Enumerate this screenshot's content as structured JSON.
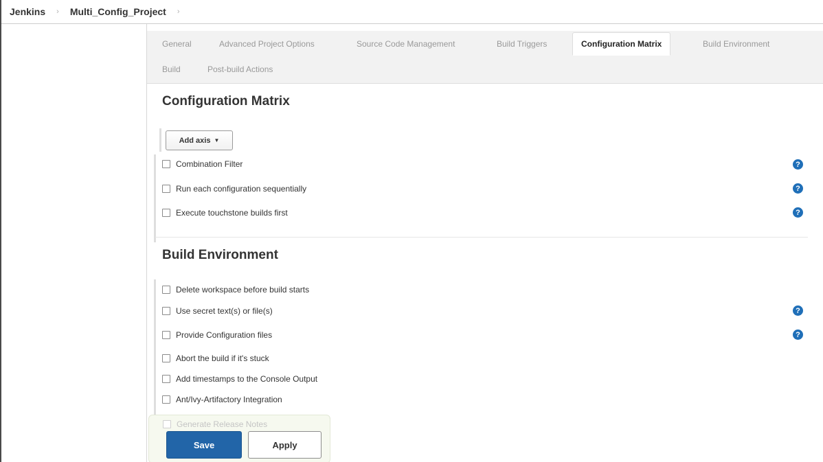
{
  "breadcrumb": {
    "root": "Jenkins",
    "project": "Multi_Config_Project"
  },
  "tabs": [
    {
      "label": "General"
    },
    {
      "label": "Advanced Project Options"
    },
    {
      "label": "Source Code Management"
    },
    {
      "label": "Build Triggers"
    },
    {
      "label": "Configuration Matrix",
      "active": true
    },
    {
      "label": "Build Environment"
    },
    {
      "label": "Build"
    },
    {
      "label": "Post-build Actions"
    }
  ],
  "configuration_matrix": {
    "title": "Configuration Matrix",
    "add_axis_label": "Add axis",
    "options": [
      {
        "label": "Combination Filter",
        "checked": false,
        "has_help": true
      },
      {
        "label": "Run each configuration sequentially",
        "checked": false,
        "has_help": true
      },
      {
        "label": "Execute touchstone builds first",
        "checked": false,
        "has_help": true
      }
    ]
  },
  "build_environment": {
    "title": "Build Environment",
    "options": [
      {
        "label": "Delete workspace before build starts",
        "checked": false,
        "has_help": false
      },
      {
        "label": "Use secret text(s) or file(s)",
        "checked": false,
        "has_help": true
      },
      {
        "label": "Provide Configuration files",
        "checked": false,
        "has_help": true
      },
      {
        "label": "Abort the build if it's stuck",
        "checked": false,
        "has_help": false
      },
      {
        "label": "Add timestamps to the Console Output",
        "checked": false,
        "has_help": false
      },
      {
        "label": "Ant/Ivy-Artifactory Integration",
        "checked": false,
        "has_help": false
      },
      {
        "label": "Generate Release Notes",
        "checked": false,
        "has_help": false
      }
    ]
  },
  "actions": {
    "save_label": "Save",
    "apply_label": "Apply"
  },
  "icons": {
    "breadcrumb_separator": "chevron-right-icon",
    "help": "help-icon",
    "dropdown": "caret-down-icon"
  },
  "colors": {
    "primary_button": "#2265a8",
    "help_icon": "#1f6fb8",
    "active_tab_bg": "#ffffff",
    "tabbar_bg": "#f2f2f2"
  }
}
